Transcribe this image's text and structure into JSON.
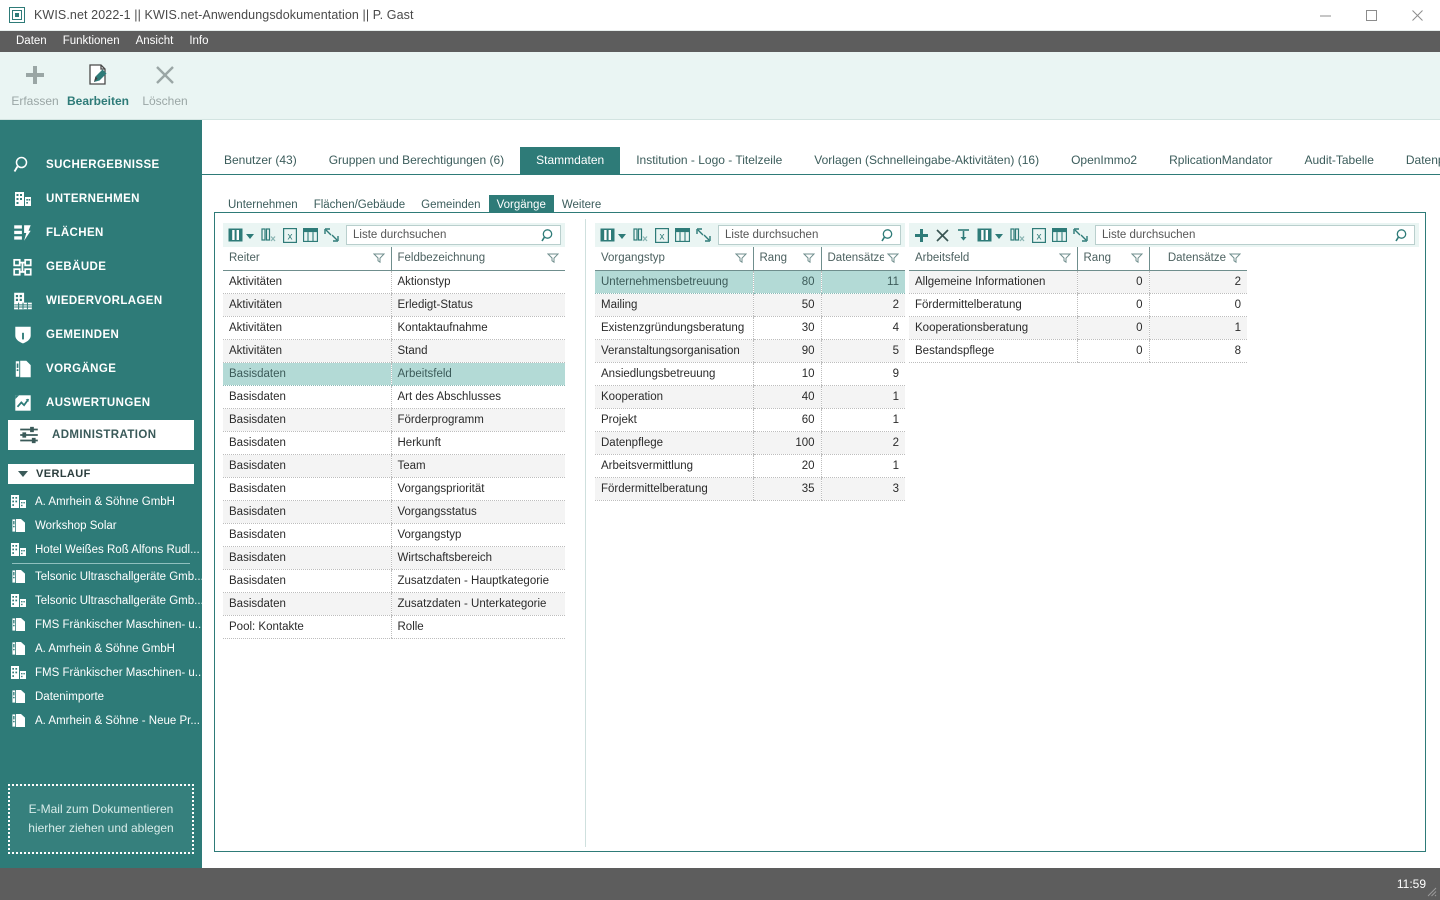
{
  "window": {
    "title": "KWIS.net 2022-1 || KWIS.net-Anwendungsdokumentation || P. Gast",
    "app_icon": "app-window-icon",
    "minimize": "minimize-icon",
    "maximize": "maximize-icon",
    "close": "close-icon"
  },
  "menubar": {
    "items": [
      {
        "label": "Daten"
      },
      {
        "label": "Funktionen"
      },
      {
        "label": "Ansicht"
      },
      {
        "label": "Info"
      }
    ]
  },
  "ribbon": {
    "buttons": [
      {
        "label": "Erfassen",
        "icon": "plus-icon",
        "state": "disabled"
      },
      {
        "label": "Bearbeiten",
        "icon": "edit-document-icon",
        "state": "active"
      },
      {
        "label": "Löschen",
        "icon": "close-x-icon",
        "state": "disabled"
      }
    ]
  },
  "sidebar": {
    "nav": [
      {
        "label": "SUCHERGEBNISSE",
        "icon": "magnifier-icon",
        "selected": false
      },
      {
        "label": "UNTERNEHMEN",
        "icon": "company-building-icon",
        "selected": false
      },
      {
        "label": "FLÄCHEN",
        "icon": "land-parcel-icon",
        "selected": false
      },
      {
        "label": "GEBÄUDE",
        "icon": "building-network-icon",
        "selected": false
      },
      {
        "label": "WIEDERVORLAGEN",
        "icon": "calendar-building-icon",
        "selected": false
      },
      {
        "label": "GEMEINDEN",
        "icon": "shield-icon",
        "selected": false
      },
      {
        "label": "VORGÄNGE",
        "icon": "binder-folder-icon",
        "selected": false
      },
      {
        "label": "AUSWERTUNGEN",
        "icon": "chart-report-icon",
        "selected": false
      },
      {
        "label": "ADMINISTRATION",
        "icon": "sliders-icon",
        "selected": true
      }
    ],
    "verlauf": {
      "label": "VERLAUF",
      "caret": "chevron-down-icon",
      "items": [
        {
          "label": "A. Amrhein & Söhne GmbH",
          "icon": "company-building-icon"
        },
        {
          "label": "Workshop Solar",
          "icon": "binder-folder-icon"
        },
        {
          "label": "Hotel Weißes Roß Alfons Rudl...",
          "icon": "company-building-icon"
        },
        {
          "label": "Telsonic Ultraschallgeräte Gmb...",
          "icon": "binder-folder-icon"
        },
        {
          "label": "Telsonic Ultraschallgeräte Gmb...",
          "icon": "company-building-icon"
        },
        {
          "label": "FMS Fränkischer Maschinen- u...",
          "icon": "binder-folder-icon"
        },
        {
          "label": "A. Amrhein & Söhne GmbH",
          "icon": "binder-folder-icon"
        },
        {
          "label": "FMS Fränkischer Maschinen- u...",
          "icon": "company-building-icon"
        },
        {
          "label": "Datenimporte",
          "icon": "binder-folder-icon"
        },
        {
          "label": "A. Amrhein & Söhne - Neue Pr...",
          "icon": "binder-folder-icon"
        }
      ],
      "separator_after_index": 2
    },
    "maildrop": {
      "line1": "E-Mail  zum Dokumentieren",
      "line2": "hierher ziehen und ablegen"
    }
  },
  "top_tabs": [
    {
      "label": "Benutzer (43)",
      "active": false
    },
    {
      "label": "Gruppen und Berechtigungen (6)",
      "active": false
    },
    {
      "label": "Stammdaten",
      "active": true
    },
    {
      "label": "Institution - Logo - Titelzeile",
      "active": false
    },
    {
      "label": "Vorlagen (Schnelleingabe-Aktivitäten) (16)",
      "active": false
    },
    {
      "label": "OpenImmo2",
      "active": false
    },
    {
      "label": "RplicationMandator",
      "active": false
    },
    {
      "label": "Audit-Tabelle",
      "active": false
    },
    {
      "label": "Datenpflege",
      "active": false
    }
  ],
  "sub_tabs": [
    {
      "label": "Unternehmen",
      "active": false
    },
    {
      "label": "Flächen/Gebäude",
      "active": false
    },
    {
      "label": "Gemeinden",
      "active": false
    },
    {
      "label": "Vorgänge",
      "active": true
    },
    {
      "label": "Weitere",
      "active": false
    }
  ],
  "grids": [
    {
      "name": "felder-grid",
      "toolbar": {
        "icons": [
          "column-chooser-icon",
          "chevron-down-icon",
          "clear-filter-icon",
          "export-excel-icon",
          "grid-layout-icon",
          "expand-collapse-icon"
        ],
        "has_crud": false,
        "search_placeholder": "Liste durchsuchen",
        "search_value": "",
        "search_icon": "magnifier-icon"
      },
      "columns": [
        {
          "label": "Reiter",
          "align": "left",
          "filter": "filter-icon"
        },
        {
          "label": "Feldbezeichnung",
          "align": "left",
          "filter": "filter-icon"
        }
      ],
      "rows": [
        {
          "cells": [
            "Aktivitäten",
            "Aktionstyp"
          ],
          "selected": false
        },
        {
          "cells": [
            "Aktivitäten",
            "Erledigt-Status"
          ],
          "selected": false
        },
        {
          "cells": [
            "Aktivitäten",
            "Kontaktaufnahme"
          ],
          "selected": false
        },
        {
          "cells": [
            "Aktivitäten",
            "Stand"
          ],
          "selected": false
        },
        {
          "cells": [
            "Basisdaten",
            "Arbeitsfeld"
          ],
          "selected": true
        },
        {
          "cells": [
            "Basisdaten",
            "Art des Abschlusses"
          ],
          "selected": false
        },
        {
          "cells": [
            "Basisdaten",
            "Förderprogramm"
          ],
          "selected": false
        },
        {
          "cells": [
            "Basisdaten",
            "Herkunft"
          ],
          "selected": false
        },
        {
          "cells": [
            "Basisdaten",
            "Team"
          ],
          "selected": false
        },
        {
          "cells": [
            "Basisdaten",
            "Vorgangspriorität"
          ],
          "selected": false
        },
        {
          "cells": [
            "Basisdaten",
            "Vorgangsstatus"
          ],
          "selected": false
        },
        {
          "cells": [
            "Basisdaten",
            "Vorgangstyp"
          ],
          "selected": false
        },
        {
          "cells": [
            "Basisdaten",
            "Wirtschaftsbereich"
          ],
          "selected": false
        },
        {
          "cells": [
            "Basisdaten",
            "Zusatzdaten - Hauptkategorie"
          ],
          "selected": false
        },
        {
          "cells": [
            "Basisdaten",
            "Zusatzdaten - Unterkategorie"
          ],
          "selected": false
        },
        {
          "cells": [
            "Pool: Kontakte",
            "Rolle"
          ],
          "selected": false
        }
      ]
    },
    {
      "name": "vorgangstyp-grid",
      "toolbar": {
        "icons": [
          "column-chooser-icon",
          "chevron-down-icon",
          "clear-filter-icon",
          "export-excel-icon",
          "grid-layout-icon",
          "expand-collapse-icon"
        ],
        "has_crud": false,
        "search_placeholder": "Liste durchsuchen",
        "search_value": "",
        "search_icon": "magnifier-icon"
      },
      "columns": [
        {
          "label": "Vorgangstyp",
          "align": "left",
          "filter": "filter-icon"
        },
        {
          "label": "Rang",
          "align": "left",
          "filter": "filter-icon"
        },
        {
          "label": "Datensätze",
          "align": "left",
          "filter": "filter-icon"
        }
      ],
      "rows": [
        {
          "cells": [
            "Unternehmensbetreuung",
            "80",
            "11"
          ],
          "selected": true
        },
        {
          "cells": [
            "Mailing",
            "50",
            "2"
          ],
          "selected": false
        },
        {
          "cells": [
            "Existenzgründungsberatung",
            "30",
            "4"
          ],
          "selected": false
        },
        {
          "cells": [
            "Veranstaltungsorganisation",
            "90",
            "5"
          ],
          "selected": false
        },
        {
          "cells": [
            "Ansiedlungsbetreuung",
            "10",
            "9"
          ],
          "selected": false
        },
        {
          "cells": [
            "Kooperation",
            "40",
            "1"
          ],
          "selected": false
        },
        {
          "cells": [
            "Projekt",
            "60",
            "1"
          ],
          "selected": false
        },
        {
          "cells": [
            "Datenpflege",
            "100",
            "2"
          ],
          "selected": false
        },
        {
          "cells": [
            "Arbeitsvermittlung",
            "20",
            "1"
          ],
          "selected": false
        },
        {
          "cells": [
            "Fördermittelberatung",
            "35",
            "3"
          ],
          "selected": false
        }
      ]
    },
    {
      "name": "arbeitsfeld-grid",
      "toolbar": {
        "icons": [
          "plus-icon",
          "close-x-icon",
          "import-down-icon",
          "column-chooser-icon",
          "chevron-down-icon",
          "clear-filter-icon",
          "export-excel-icon",
          "grid-layout-icon",
          "expand-collapse-icon"
        ],
        "has_crud": true,
        "search_placeholder": "Liste durchsuchen",
        "search_value": "",
        "search_icon": "magnifier-icon"
      },
      "columns": [
        {
          "label": "Arbeitsfeld",
          "align": "left",
          "filter": "filter-icon"
        },
        {
          "label": "Rang",
          "align": "left",
          "filter": "filter-icon"
        },
        {
          "label": "Datensätze",
          "align": "right",
          "filter": "filter-icon"
        }
      ],
      "rows": [
        {
          "cells": [
            "Allgemeine Informationen",
            "0",
            "2"
          ],
          "selected": false
        },
        {
          "cells": [
            "Fördermittelberatung",
            "0",
            "0"
          ],
          "selected": false
        },
        {
          "cells": [
            "Kooperationsberatung",
            "0",
            "1"
          ],
          "selected": false
        },
        {
          "cells": [
            "Bestandspflege",
            "0",
            "8"
          ],
          "selected": false
        }
      ]
    }
  ],
  "statusbar": {
    "time": "11:59",
    "grip": "resize-grip-icon"
  },
  "colors": {
    "brand_teal": "#2e7b78",
    "ribbon_bg": "#eaf5f3",
    "menu_gray": "#5d5d5d",
    "selection": "#b3dad6",
    "alt_row": "#f4f4f4"
  }
}
